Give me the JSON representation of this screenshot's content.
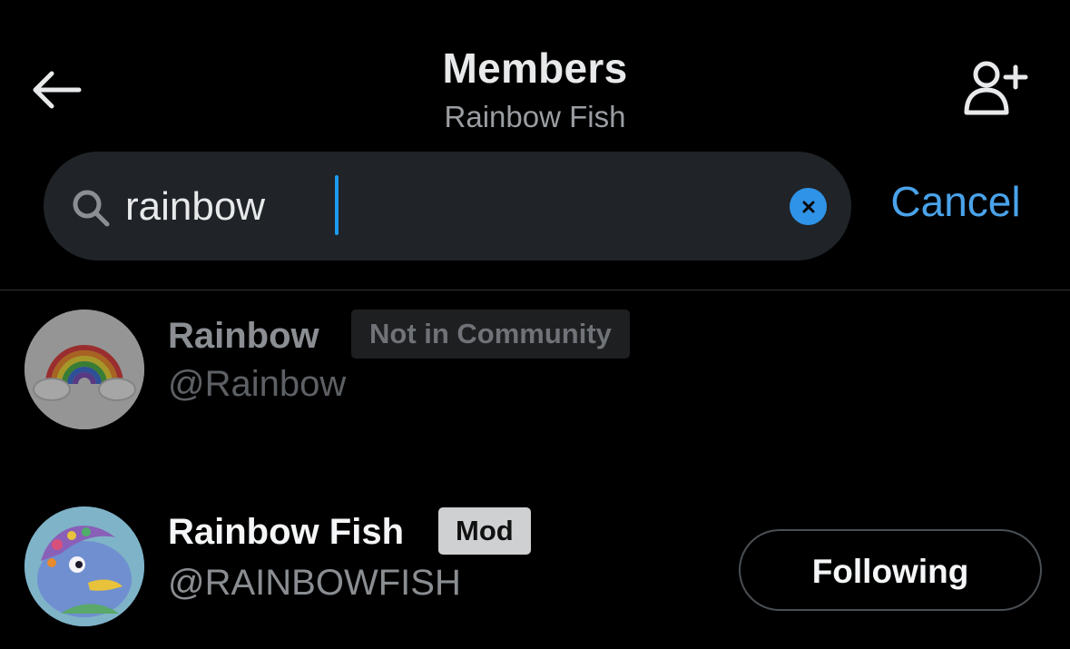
{
  "header": {
    "title": "Members",
    "subtitle": "Rainbow Fish",
    "back_icon": "arrow-left-icon",
    "add_member_icon": "person-plus-icon"
  },
  "search": {
    "value": "rainbow",
    "cancel_label": "Cancel",
    "accent_color": "#1d9bf0"
  },
  "results": [
    {
      "name": "Rainbow",
      "handle": "@Rainbow",
      "badge": "Not in Community",
      "avatar_icon": "rainbow-icon"
    },
    {
      "name": "Rainbow Fish",
      "handle": "@RAINBOWFISH",
      "badge": "Mod",
      "action": "Following",
      "avatar_icon": "rainbow-fish-illustration"
    }
  ]
}
